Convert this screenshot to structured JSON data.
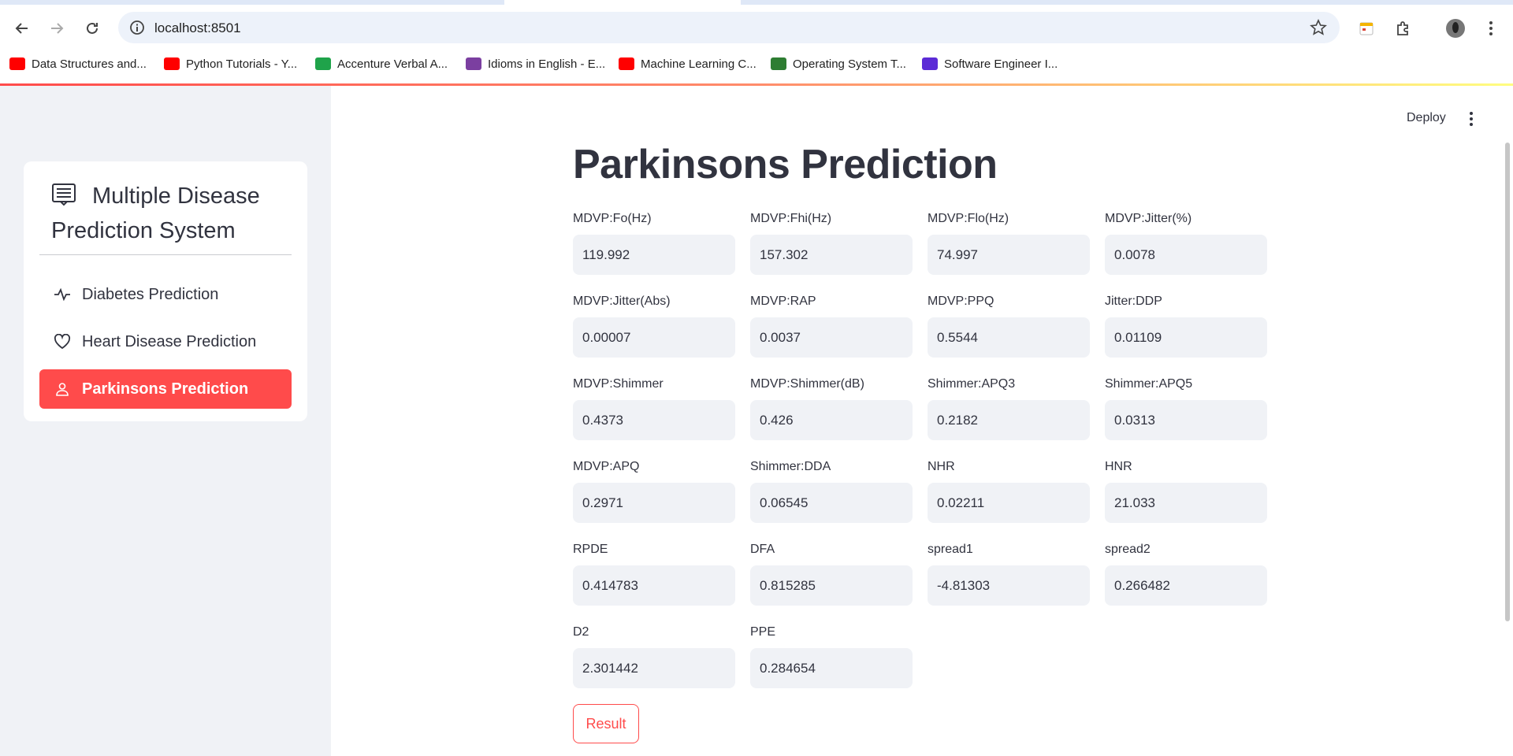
{
  "browser": {
    "url": "localhost:8501",
    "bookmarks": [
      {
        "label": "Data Structures and...",
        "color": "#ff0000"
      },
      {
        "label": "Python Tutorials - Y...",
        "color": "#ff0000"
      },
      {
        "label": "Accenture Verbal A...",
        "color": "#1fa34a"
      },
      {
        "label": "Idioms in English - E...",
        "color": "#7b3fa0"
      },
      {
        "label": "Machine Learning C...",
        "color": "#ff0000"
      },
      {
        "label": "Operating System T...",
        "color": "#2e7d32"
      },
      {
        "label": "Software Engineer I...",
        "color": "#5b2bd6"
      }
    ]
  },
  "sidebar": {
    "title": "Multiple Disease Prediction System",
    "items": [
      {
        "label": "Diabetes Prediction",
        "icon": "activity-icon",
        "active": false
      },
      {
        "label": "Heart Disease Prediction",
        "icon": "heart-icon",
        "active": false
      },
      {
        "label": "Parkinsons Prediction",
        "icon": "person-icon",
        "active": true
      }
    ],
    "accent": "#ff4b4b"
  },
  "header": {
    "deploy_label": "Deploy"
  },
  "main": {
    "title": "Parkinsons Prediction",
    "fields": [
      {
        "label": "MDVP:Fo(Hz)",
        "value": "119.992"
      },
      {
        "label": "MDVP:Fhi(Hz)",
        "value": "157.302"
      },
      {
        "label": "MDVP:Flo(Hz)",
        "value": "74.997"
      },
      {
        "label": "MDVP:Jitter(%)",
        "value": "0.0078"
      },
      {
        "label": "MDVP:Jitter(Abs)",
        "value": "0.00007"
      },
      {
        "label": "MDVP:RAP",
        "value": "0.0037"
      },
      {
        "label": "MDVP:PPQ",
        "value": "0.5544"
      },
      {
        "label": "Jitter:DDP",
        "value": "0.01109"
      },
      {
        "label": "MDVP:Shimmer",
        "value": "0.4373"
      },
      {
        "label": "MDVP:Shimmer(dB)",
        "value": "0.426"
      },
      {
        "label": "Shimmer:APQ3",
        "value": "0.2182"
      },
      {
        "label": "Shimmer:APQ5",
        "value": "0.0313"
      },
      {
        "label": "MDVP:APQ",
        "value": "0.2971"
      },
      {
        "label": "Shimmer:DDA",
        "value": "0.06545"
      },
      {
        "label": "NHR",
        "value": "0.02211"
      },
      {
        "label": "HNR",
        "value": "21.033"
      },
      {
        "label": "RPDE",
        "value": "0.414783"
      },
      {
        "label": "DFA",
        "value": "0.815285"
      },
      {
        "label": "spread1",
        "value": "-4.81303"
      },
      {
        "label": "spread2",
        "value": "0.266482"
      },
      {
        "label": "D2",
        "value": "2.301442"
      },
      {
        "label": "PPE",
        "value": "0.284654"
      }
    ],
    "result_label": "Result"
  }
}
